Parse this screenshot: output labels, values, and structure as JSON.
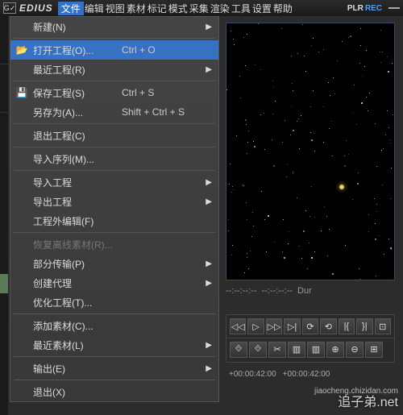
{
  "app": {
    "logo": "G✓",
    "name": "EDIUS"
  },
  "menu": {
    "items": [
      "文件",
      "编辑",
      "视图",
      "素材",
      "标记",
      "模式",
      "采集",
      "渲染",
      "工具",
      "设置",
      "帮助"
    ],
    "active_index": 0
  },
  "status": {
    "plr": "PLR",
    "rec": "REC"
  },
  "dropdown": {
    "groups": [
      [
        {
          "label": "新建(N)",
          "shortcut": "",
          "icon": "",
          "arrow": true,
          "sel": false
        }
      ],
      [
        {
          "label": "打开工程(O)...",
          "shortcut": "Ctrl + O",
          "icon": "📂",
          "arrow": false,
          "sel": true
        },
        {
          "label": "最近工程(R)",
          "shortcut": "",
          "icon": "",
          "arrow": true,
          "sel": false
        }
      ],
      [
        {
          "label": "保存工程(S)",
          "shortcut": "Ctrl + S",
          "icon": "💾",
          "arrow": false,
          "sel": false
        },
        {
          "label": "另存为(A)...",
          "shortcut": "Shift + Ctrl + S",
          "icon": "",
          "arrow": false,
          "sel": false
        }
      ],
      [
        {
          "label": "退出工程(C)",
          "shortcut": "",
          "icon": "",
          "arrow": false,
          "sel": false
        }
      ],
      [
        {
          "label": "导入序列(M)...",
          "shortcut": "",
          "icon": "",
          "arrow": false,
          "sel": false
        }
      ],
      [
        {
          "label": "导入工程",
          "shortcut": "",
          "icon": "",
          "arrow": true,
          "sel": false
        },
        {
          "label": "导出工程",
          "shortcut": "",
          "icon": "",
          "arrow": true,
          "sel": false
        },
        {
          "label": "工程外编辑(F)",
          "shortcut": "",
          "icon": "",
          "arrow": false,
          "sel": false
        }
      ],
      [
        {
          "label": "恢复离线素材(R)...",
          "shortcut": "",
          "icon": "",
          "arrow": false,
          "sel": false,
          "disabled": true
        },
        {
          "label": "部分传输(P)",
          "shortcut": "",
          "icon": "",
          "arrow": true,
          "sel": false
        },
        {
          "label": "创建代理",
          "shortcut": "",
          "icon": "",
          "arrow": true,
          "sel": false
        },
        {
          "label": "优化工程(T)...",
          "shortcut": "",
          "icon": "",
          "arrow": false,
          "sel": false
        }
      ],
      [
        {
          "label": "添加素材(C)...",
          "shortcut": "",
          "icon": "",
          "arrow": false,
          "sel": false
        },
        {
          "label": "最近素材(L)",
          "shortcut": "",
          "icon": "",
          "arrow": true,
          "sel": false
        }
      ],
      [
        {
          "label": "输出(E)",
          "shortcut": "",
          "icon": "",
          "arrow": true,
          "sel": false
        }
      ],
      [
        {
          "label": "退出(X)",
          "shortcut": "",
          "icon": "",
          "arrow": false,
          "sel": false
        }
      ]
    ]
  },
  "preview_info": {
    "in": "--:--:--:--",
    "out": "--:--:--:--",
    "dur_label": "Dur"
  },
  "transport": {
    "row1": [
      "◁◁",
      "▷",
      "▷▷",
      "▷|",
      "⟳",
      "⟲",
      "|{",
      "}|",
      "⊡"
    ],
    "row2": [
      "⟐",
      "⟐",
      "✂",
      "▥",
      "▥",
      "⊕",
      "⊖",
      "⊞"
    ]
  },
  "timecodes": {
    "tc1": "+00:00:42:00",
    "tc2": "+00:00:42:00"
  },
  "watermark": {
    "small": "jiaocheng.chizidan.com",
    "large": "追子弟.net"
  }
}
